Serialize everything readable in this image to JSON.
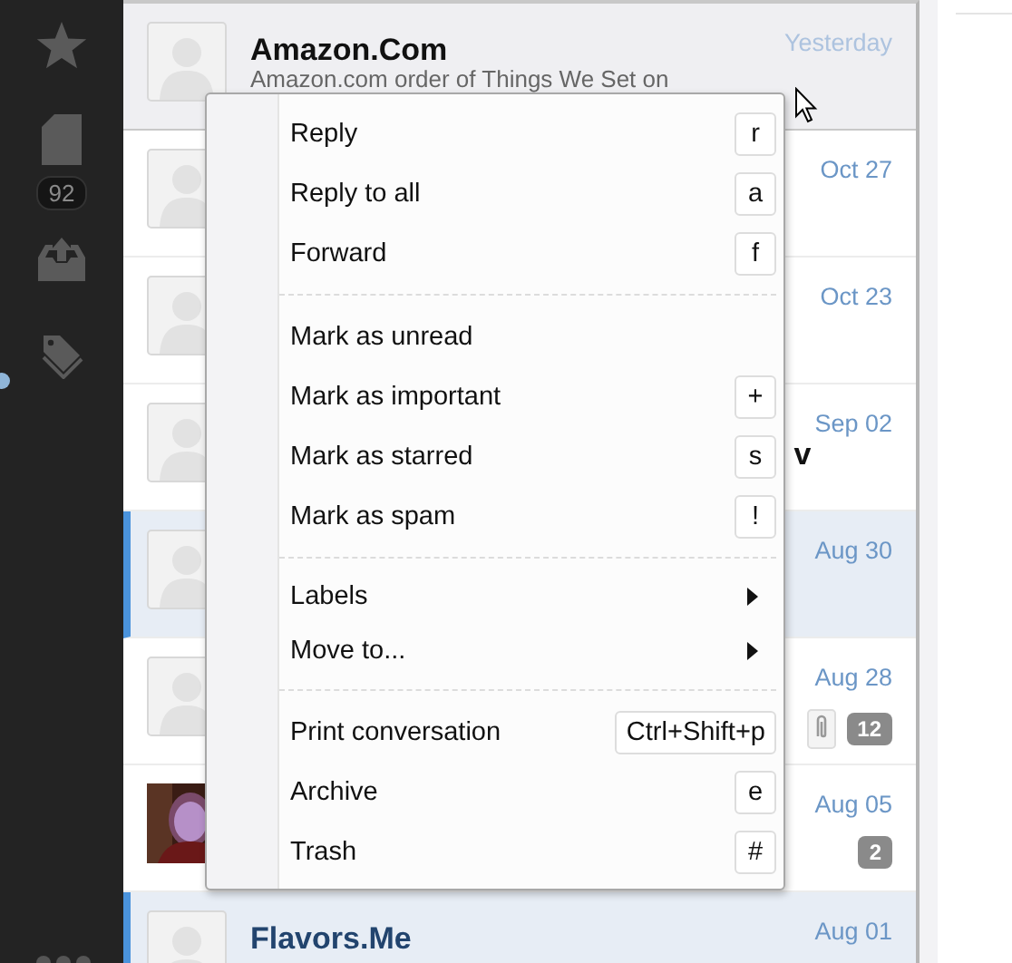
{
  "sidebar": {
    "badge": "92"
  },
  "messages": [
    {
      "sender": "Amazon.Com",
      "snippet": "Amazon.com order of Things We Set on",
      "date": "Yesterday",
      "selected": false,
      "hovered": true,
      "kind": "contact"
    },
    {
      "date": "Oct 27",
      "selected": false,
      "hovered": false,
      "kind": "contact"
    },
    {
      "date": "Oct 23",
      "selected": false,
      "hovered": false,
      "kind": "contact"
    },
    {
      "sender": "v",
      "sender_clipped": true,
      "date": "Sep 02",
      "selected": false,
      "hovered": false,
      "kind": "contact"
    },
    {
      "date": "Aug 30",
      "selected": true,
      "hovered": false,
      "kind": "contact"
    },
    {
      "date": "Aug 28",
      "selected": false,
      "hovered": false,
      "kind": "contact",
      "attachment": true,
      "count": "12"
    },
    {
      "date": "Aug 05",
      "selected": false,
      "hovered": false,
      "count": "2"
    },
    {
      "sender": "Flavors.Me",
      "date": "Aug 01",
      "selected": true,
      "hovered": false,
      "kind": "contact"
    }
  ],
  "context_menu": {
    "groups": [
      [
        {
          "label": "Reply",
          "kind": "shortcut",
          "shortcut": "r"
        },
        {
          "label": "Reply to all",
          "kind": "shortcut",
          "shortcut": "a"
        },
        {
          "label": "Forward",
          "kind": "shortcut",
          "shortcut": "f"
        }
      ],
      [
        {
          "label": "Mark as unread",
          "kind": "plain"
        },
        {
          "label": "Mark as important",
          "kind": "shortcut",
          "shortcut": "+"
        },
        {
          "label": "Mark as starred",
          "kind": "shortcut",
          "shortcut": "s"
        },
        {
          "label": "Mark as spam",
          "kind": "shortcut",
          "shortcut": "!"
        }
      ],
      [
        {
          "label": "Labels",
          "kind": "submenu"
        },
        {
          "label": "Move to...",
          "kind": "submenu"
        }
      ],
      [
        {
          "label": "Print conversation",
          "kind": "shortcut",
          "shortcut": "Ctrl+Shift+p"
        },
        {
          "label": "Archive",
          "kind": "shortcut",
          "shortcut": "e"
        },
        {
          "label": "Trash",
          "kind": "shortcut",
          "shortcut": "#"
        }
      ]
    ]
  }
}
